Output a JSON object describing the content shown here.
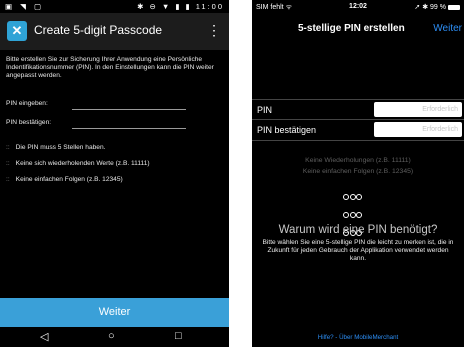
{
  "android": {
    "status": {
      "left_icons": "▣ ◥ ▢",
      "right_icons": "✱ ⊖ ▼ ▮ ▮",
      "time": "11:00"
    },
    "appbar": {
      "title": "Create 5-digit Passcode",
      "menu_icon": "overflow-menu-icon"
    },
    "intro": "Bitte erstellen Sie zur Sicherung Ihrer Anwendung eine Persönliche Indentifikationsnummer (PIN). In den Einstellungen kann die PIN weiter angepasst werden.",
    "pin_label": "PIN eingeben:",
    "confirm_label": "PIN bestätigen:",
    "rules": [
      "Die PIN muss 5 Stellen haben.",
      "Keine sich wiederholenden Werte (z.B. 11111)",
      "Keine einfachen Folgen (z.B. 12345)"
    ],
    "bullet": "::",
    "button": "Weiter",
    "nav": {
      "back": "◁",
      "home": "○",
      "recents": "□"
    },
    "accent": "#3aa0d8"
  },
  "ios": {
    "status": {
      "carrier": "SIM fehlt ᯤ",
      "time": "12:02",
      "right": "➚ ✱ 99 %"
    },
    "nav": {
      "title": "5-stellige PIN erstellen",
      "action": "Weiter"
    },
    "fields": [
      {
        "label": "PIN",
        "placeholder": "Erforderlich"
      },
      {
        "label": "PIN bestätigen",
        "placeholder": "Erforderlich"
      }
    ],
    "hints": [
      "Keine Wiederholungen (z.B. 11111)",
      "Keine einfachen Folgen (z.B. 12345)"
    ],
    "keypad_icon": "keypad-icon",
    "why_title": "Warum wird eine PIN benötigt?",
    "why_text": "Bitte wählen Sie eine 5-stellige PIN die leicht zu merken ist, die in Zukunft für jeden Gebrauch der Applikation verwendet werden kann.",
    "footer": "Hilfe? - Über MobileMerchant",
    "accent": "#2d8ef5"
  }
}
